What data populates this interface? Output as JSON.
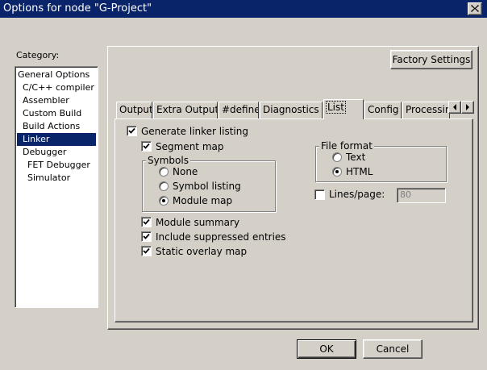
{
  "window": {
    "title": "Options for node \"G-Project\""
  },
  "category": {
    "label": "Category:",
    "items": [
      {
        "label": "General Options",
        "indent": 0
      },
      {
        "label": "C/C++ compiler",
        "indent": 1
      },
      {
        "label": "Assembler",
        "indent": 1
      },
      {
        "label": "Custom Build",
        "indent": 1
      },
      {
        "label": "Build Actions",
        "indent": 1
      },
      {
        "label": "Linker",
        "indent": 1,
        "selected": true
      },
      {
        "label": "Debugger",
        "indent": 1
      },
      {
        "label": "FET Debugger",
        "indent": 2
      },
      {
        "label": "Simulator",
        "indent": 2
      }
    ]
  },
  "factory_settings_label": "Factory Settings",
  "tabs": [
    {
      "label": "Output"
    },
    {
      "label": "Extra Output"
    },
    {
      "label": "#define"
    },
    {
      "label": "Diagnostics"
    },
    {
      "label": "List",
      "active": true
    },
    {
      "label": "Config"
    },
    {
      "label": "Processing"
    }
  ],
  "list_tab": {
    "generate_listing": {
      "label": "Generate linker listing",
      "checked": true
    },
    "segment_map": {
      "label": "Segment map",
      "checked": true
    },
    "symbols": {
      "title": "Symbols",
      "options": [
        {
          "label": "None",
          "selected": false
        },
        {
          "label": "Symbol listing",
          "selected": false
        },
        {
          "label": "Module map",
          "selected": true
        }
      ]
    },
    "module_summary": {
      "label": "Module summary",
      "checked": true
    },
    "include_suppressed": {
      "label": "Include suppressed entries",
      "checked": true
    },
    "static_overlay": {
      "label": "Static overlay map",
      "checked": true
    },
    "file_format": {
      "title": "File format",
      "options": [
        {
          "label": "Text",
          "selected": false
        },
        {
          "label": "HTML",
          "selected": true
        }
      ]
    },
    "lines_per_page": {
      "label": "Lines/page:",
      "checked": false,
      "value": "80"
    }
  },
  "buttons": {
    "ok": "OK",
    "cancel": "Cancel"
  }
}
